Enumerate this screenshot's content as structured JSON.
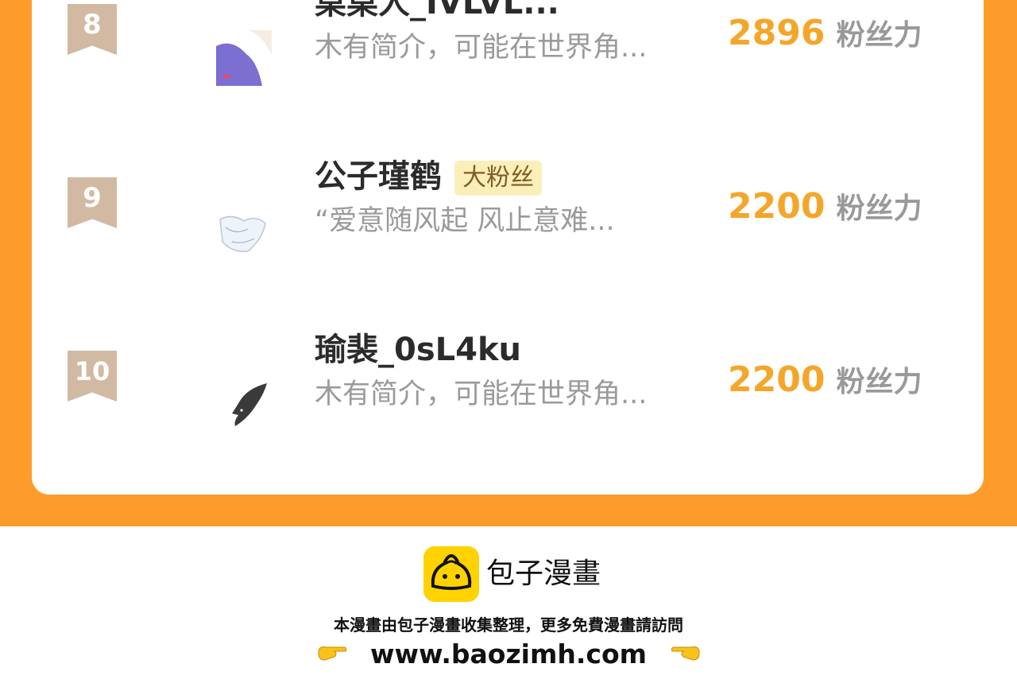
{
  "rankings": [
    {
      "rank": "8",
      "name": "桌桌人_IVLVL...",
      "badge": "",
      "bio": "木有简介，可能在世界角...",
      "score": "2896",
      "unit": "粉丝力",
      "avatar_icon": "avatar-illustration-purple"
    },
    {
      "rank": "9",
      "name": "公子瑾鹤",
      "badge": "大粉丝",
      "bio": "“爱意随风起 风止意难...",
      "score": "2200",
      "unit": "粉丝力",
      "avatar_icon": "avatar-sketch"
    },
    {
      "rank": "10",
      "name": "瑜裴_0sL4ku",
      "badge": "",
      "bio": "木有简介，可能在世界角...",
      "score": "2200",
      "unit": "粉丝力",
      "avatar_icon": "avatar-shark"
    }
  ],
  "footer": {
    "brand": "包子漫畫",
    "note": "本漫畫由包子漫畫收集整理，更多免費漫畫請訪問",
    "url": "www.baozimh.com",
    "left_icon": "pointing-right-hand-icon",
    "right_icon": "pointing-left-hand-icon"
  },
  "colors": {
    "band": "#fd9c2b",
    "score": "#f4a62b",
    "rank_ribbon": "#d2b9a2",
    "badge_bg": "#fbefb9",
    "logo": "#ffd200"
  }
}
